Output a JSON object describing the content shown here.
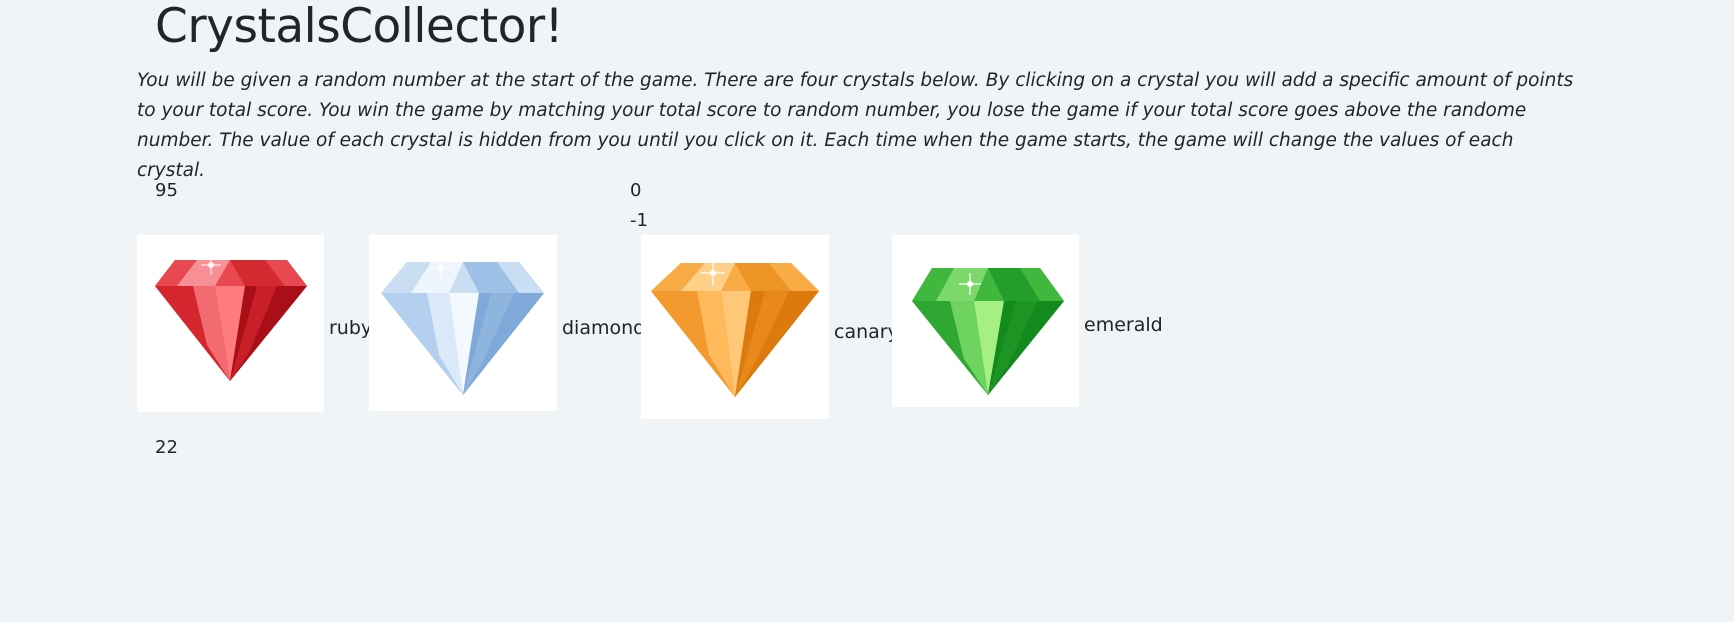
{
  "header": {
    "title": "CrystalsCollector!"
  },
  "instructions": "You will be given a random number at the start of the game. There are four crystals below. By clicking on a crystal you will add a specific amount of points to your total score. You win the game by matching your total score to random number, you lose the game if your total score goes above the randome number. The value of each crystal is hidden from you until you click on it. Each time when the game starts, the game will change the values of each crystal.",
  "game": {
    "target_number": "95",
    "total_score": "0",
    "last_value": "-1",
    "bottom_counter": "22"
  },
  "crystals": [
    {
      "label": "ruby",
      "color": "#e8333c",
      "icon": "ruby-crystal-icon"
    },
    {
      "label": "diamond",
      "color": "#a9c9ea",
      "icon": "diamond-crystal-icon"
    },
    {
      "label": "canary",
      "color": "#f5a030",
      "icon": "canary-crystal-icon"
    },
    {
      "label": "emerald",
      "color": "#2fa835",
      "icon": "emerald-crystal-icon"
    }
  ]
}
